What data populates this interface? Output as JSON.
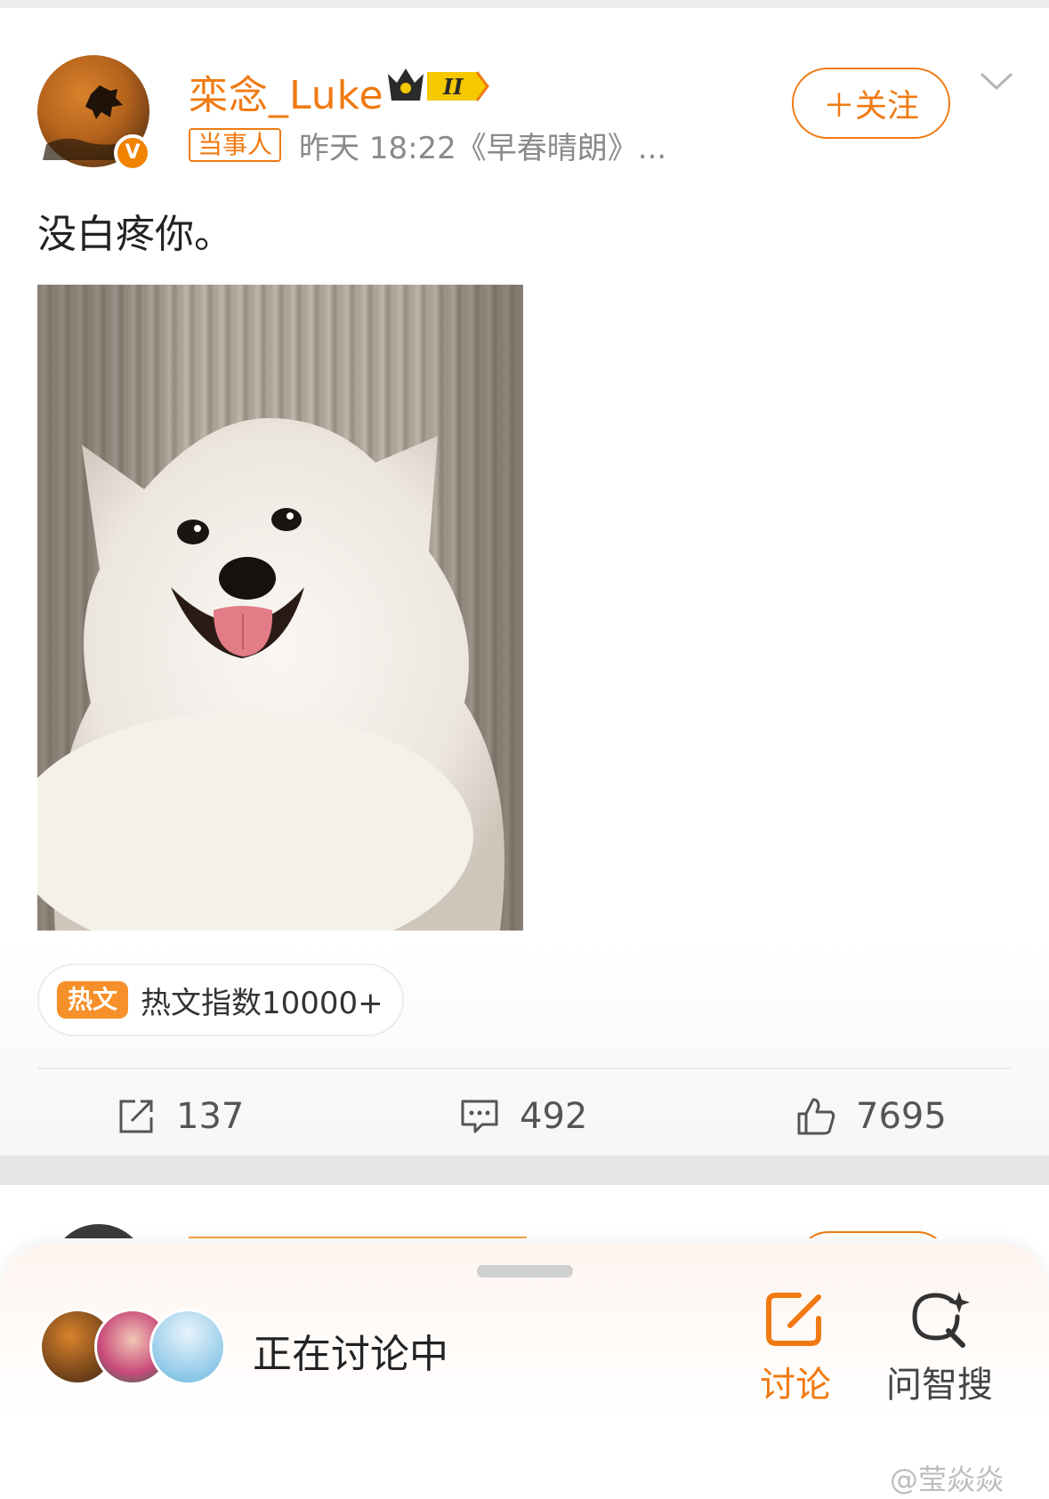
{
  "post": {
    "author": "栾念_Luke",
    "verified_badge": "V",
    "crown_level": "II",
    "tag": "当事人",
    "meta": "昨天 18:22《早春晴朗》...",
    "follow_label": "＋关注",
    "text": "没白疼你。",
    "hot_badge": "热文",
    "hot_text": "热文指数10000+",
    "actions": {
      "repost_count": "137",
      "comment_count": "492",
      "like_count": "7695"
    }
  },
  "sheet": {
    "discussing_label": "正在讨论中",
    "discuss_label": "讨论",
    "search_label": "问智搜"
  },
  "watermark": "@莹焱焱",
  "colors": {
    "accent": "#f07a12",
    "hot_badge": "#f6902a",
    "meta_gray": "#8a8a8a"
  },
  "icons": {
    "repost": "repost-icon",
    "comment": "comment-icon",
    "like": "thumbs-up-icon",
    "discuss": "edit-square-icon",
    "search": "sparkle-search-icon",
    "menu": "chevron-down-icon"
  }
}
